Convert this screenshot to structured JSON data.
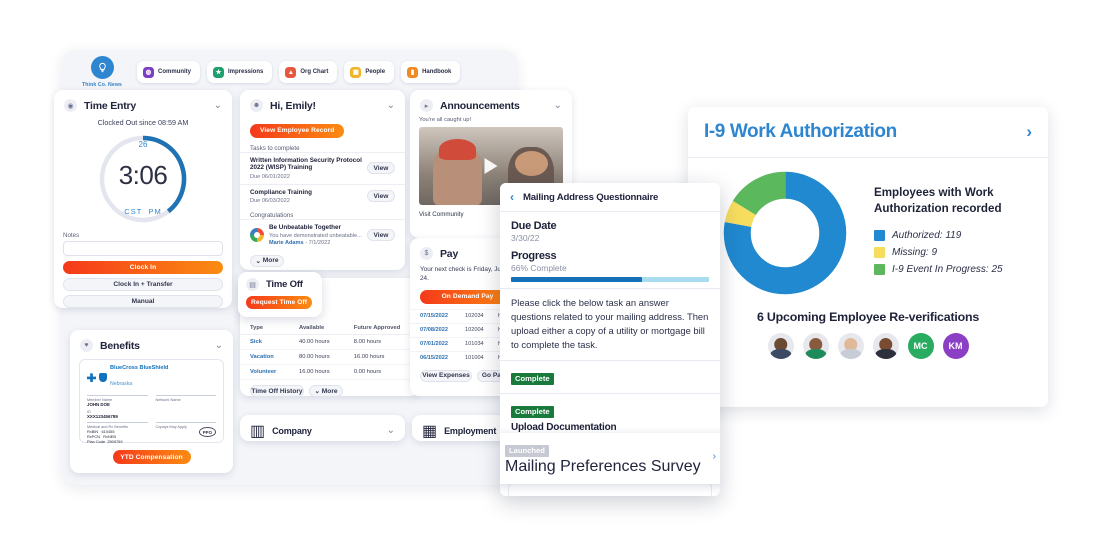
{
  "brand": {
    "name": "Think Co. News",
    "icon": "lightbulb-icon"
  },
  "topnav": {
    "items": [
      {
        "label": "Community",
        "icon": "community-icon",
        "color": "#7b3fc4"
      },
      {
        "label": "Impressions",
        "icon": "star-icon",
        "color": "#1f9e6e"
      },
      {
        "label": "Org Chart",
        "icon": "org-chart-icon",
        "color": "#e8563f"
      },
      {
        "label": "People",
        "icon": "people-icon",
        "color": "#f0b429"
      },
      {
        "label": "Handbook",
        "icon": "handbook-icon",
        "color": "#f08a24"
      }
    ]
  },
  "time_entry": {
    "title": "Time Entry",
    "status": "Clocked Out since 08:59 AM",
    "day": "26",
    "clock": "3:06",
    "timezone": "CST",
    "meridiem": "PM",
    "notes_label": "Notes",
    "notes_value": "",
    "buttons": [
      "Clock In",
      "Clock In + Transfer",
      "Manual"
    ]
  },
  "benefits": {
    "title": "Benefits",
    "plan_name": "BlueCross BlueShield",
    "plan_region": "Nebraska",
    "member_name_label": "Member Name",
    "member_name": "JOHN DOE",
    "id_label": "ID",
    "id_value": "XXX123456789",
    "network_label": "Network Name",
    "medical_label": "Medical and Rx Benefits",
    "copays_label": "Copays May Apply",
    "rows": [
      {
        "k": "RxBIN",
        "v": "610455"
      },
      {
        "k": "RxPCN",
        "v": "RxNEB"
      },
      {
        "k": "Plan Code",
        "v": "2509759"
      }
    ],
    "plan_type": "PPO",
    "cta": "YTD Compensation"
  },
  "hi_emily": {
    "title": "Hi, Emily!",
    "cta": "View Employee Record",
    "tasks_label": "Tasks to complete",
    "tasks": [
      {
        "title": "Written Information Security Protocol 2022 (WISP) Training",
        "due": "Due 06/01/2022",
        "action": "View"
      },
      {
        "title": "Compliance Training",
        "due": "Due 06/03/2022",
        "action": "View"
      }
    ],
    "congrats_label": "Congratulations",
    "congrats": {
      "title": "Be Unbeatable Together",
      "desc": "You have demonstrated unbeatable...",
      "author": "Marie Adams",
      "date": "- 7/1/2022",
      "action": "View"
    },
    "more": "More"
  },
  "time_off": {
    "title": "Time Off",
    "cta": "Request Time Off",
    "columns": [
      "Type",
      "Available",
      "Future Approved"
    ],
    "rows": [
      {
        "type": "Sick",
        "available": "40.00 hours",
        "future": "8.00 hours"
      },
      {
        "type": "Vacation",
        "available": "80.00 hours",
        "future": "16.00 hours"
      },
      {
        "type": "Volunteer",
        "available": "16.00 hours",
        "future": "0.00 hours"
      }
    ],
    "history_btn": "Time Off History",
    "more_btn": "More"
  },
  "announcements": {
    "title": "Announcements",
    "status": "You're all caught up!",
    "visit": "Visit Community"
  },
  "pay": {
    "title": "Pay",
    "next_check": "Your next check is Friday, Jul 11 - Jul 24.",
    "cta": "On Demand Pay",
    "rows": [
      {
        "date": "07/15/2022",
        "num": "102034",
        "amount": "hidden"
      },
      {
        "date": "07/08/2022",
        "num": "102004",
        "amount": "hidden"
      },
      {
        "date": "07/01/2022",
        "num": "101034",
        "amount": "hidden"
      },
      {
        "date": "06/15/2022",
        "num": "101004",
        "amount": "hidden"
      }
    ],
    "expenses_btn": "View Expenses",
    "paper_btn": "Go Paperless"
  },
  "company": {
    "title": "Company"
  },
  "employment": {
    "title": "Employment"
  },
  "mailing_modal": {
    "title": "Mailing Address Questionnaire",
    "back_icon": "chevron-left-icon",
    "due_date_label": "Due Date",
    "due_date": "3/30/22",
    "progress_label": "Progress",
    "progress_text": "66% Complete",
    "progress_percent": 66,
    "description": "Please click the below task an answer questions related to your mailing address. Then upload either a copy of a utility or mortgage bill to complete the task.",
    "tasks": [
      {
        "status": "Complete",
        "name": ""
      },
      {
        "status": "Complete",
        "name": "Upload Documentation"
      },
      {
        "status": "Launched",
        "name": "Mailing Preferences Survey"
      }
    ]
  },
  "i9_panel": {
    "title": "I-9 Work Authorization",
    "arrow_icon": "chevron-right-icon",
    "subtitle": "Employees with Work Authorization recorded",
    "reverifications_title": "6 Upcoming Employee Re-verifications",
    "avatars": [
      {
        "type": "photo",
        "label": ""
      },
      {
        "type": "photo",
        "label": ""
      },
      {
        "type": "photo",
        "label": ""
      },
      {
        "type": "photo",
        "label": ""
      },
      {
        "type": "initials",
        "label": "MC",
        "color": "#2aab62"
      },
      {
        "type": "initials",
        "label": "KM",
        "color": "#8b3fc4"
      }
    ]
  },
  "chart_data": {
    "type": "pie",
    "title": "Employees with Work Authorization recorded",
    "categories": [
      "Authorized",
      "Missing",
      "I-9 Event In Progress"
    ],
    "values": [
      119,
      9,
      25
    ],
    "colors": [
      "#2089cf",
      "#f7dd5e",
      "#5cb85c"
    ],
    "legend_labels": [
      "Authorized: 119",
      "Missing: 9",
      "I-9 Event In Progress: 25"
    ],
    "legend_position": "right",
    "donut": true,
    "total": 153
  }
}
